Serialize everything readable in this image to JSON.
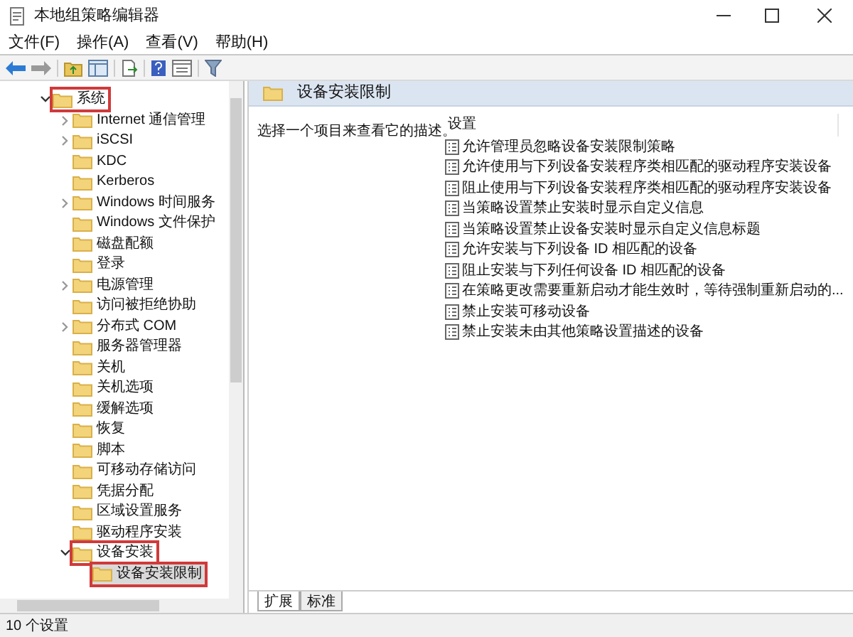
{
  "window": {
    "title": "本地组策略编辑器"
  },
  "menu": [
    "文件(F)",
    "操作(A)",
    "查看(V)",
    "帮助(H)"
  ],
  "tree": [
    {
      "label": "系统",
      "expandable": true,
      "expanded": true,
      "selected": false,
      "annotated": true,
      "children": [
        {
          "label": "Internet 通信管理",
          "expandable": true,
          "expanded": false,
          "selected": false,
          "annotated": false
        },
        {
          "label": "iSCSI",
          "expandable": true,
          "expanded": false,
          "selected": false,
          "annotated": false
        },
        {
          "label": "KDC",
          "expandable": false,
          "expanded": false,
          "selected": false,
          "annotated": false
        },
        {
          "label": "Kerberos",
          "expandable": false,
          "expanded": false,
          "selected": false,
          "annotated": false
        },
        {
          "label": "Windows 时间服务",
          "expandable": true,
          "expanded": false,
          "selected": false,
          "annotated": false
        },
        {
          "label": "Windows 文件保护",
          "expandable": false,
          "expanded": false,
          "selected": false,
          "annotated": false
        },
        {
          "label": "磁盘配额",
          "expandable": false,
          "expanded": false,
          "selected": false,
          "annotated": false
        },
        {
          "label": "登录",
          "expandable": false,
          "expanded": false,
          "selected": false,
          "annotated": false
        },
        {
          "label": "电源管理",
          "expandable": true,
          "expanded": false,
          "selected": false,
          "annotated": false
        },
        {
          "label": "访问被拒绝协助",
          "expandable": false,
          "expanded": false,
          "selected": false,
          "annotated": false
        },
        {
          "label": "分布式 COM",
          "expandable": true,
          "expanded": false,
          "selected": false,
          "annotated": false
        },
        {
          "label": "服务器管理器",
          "expandable": false,
          "expanded": false,
          "selected": false,
          "annotated": false
        },
        {
          "label": "关机",
          "expandable": false,
          "expanded": false,
          "selected": false,
          "annotated": false
        },
        {
          "label": "关机选项",
          "expandable": false,
          "expanded": false,
          "selected": false,
          "annotated": false
        },
        {
          "label": "缓解选项",
          "expandable": false,
          "expanded": false,
          "selected": false,
          "annotated": false
        },
        {
          "label": "恢复",
          "expandable": false,
          "expanded": false,
          "selected": false,
          "annotated": false
        },
        {
          "label": "脚本",
          "expandable": false,
          "expanded": false,
          "selected": false,
          "annotated": false
        },
        {
          "label": "可移动存储访问",
          "expandable": false,
          "expanded": false,
          "selected": false,
          "annotated": false
        },
        {
          "label": "凭据分配",
          "expandable": false,
          "expanded": false,
          "selected": false,
          "annotated": false
        },
        {
          "label": "区域设置服务",
          "expandable": false,
          "expanded": false,
          "selected": false,
          "annotated": false
        },
        {
          "label": "驱动程序安装",
          "expandable": false,
          "expanded": false,
          "selected": false,
          "annotated": false
        },
        {
          "label": "设备安装",
          "expandable": true,
          "expanded": true,
          "selected": false,
          "annotated": true,
          "children": [
            {
              "label": "设备安装限制",
              "expandable": false,
              "expanded": false,
              "selected": true,
              "annotated": true
            }
          ]
        }
      ]
    }
  ],
  "details": {
    "title": "设备安装限制",
    "description": "选择一个项目来查看它的描述。",
    "column": "设置",
    "settings": [
      "允许管理员忽略设备安装限制策略",
      "允许使用与下列设备安装程序类相匹配的驱动程序安装设备",
      "阻止使用与下列设备安装程序类相匹配的驱动程序安装设备",
      "当策略设置禁止安装时显示自定义信息",
      "当策略设置禁止设备安装时显示自定义信息标题",
      "允许安装与下列设备 ID 相匹配的设备",
      "阻止安装与下列任何设备 ID 相匹配的设备",
      "在策略更改需要重新启动才能生效时，等待强制重新启动的...",
      "禁止安装可移动设备",
      "禁止安装未由其他策略设置描述的设备"
    ]
  },
  "tabs": [
    {
      "label": "扩展",
      "selected": true
    },
    {
      "label": "标准",
      "selected": false
    }
  ],
  "status_bar": "10 个设置"
}
